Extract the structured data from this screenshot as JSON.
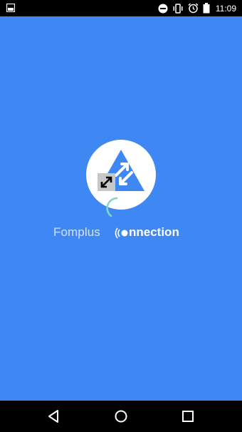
{
  "status_bar": {
    "left_icon": "image-notification-icon",
    "icons": [
      "do-not-disturb-icon",
      "vibrate-icon",
      "alarm-icon",
      "battery-icon"
    ],
    "time": "11:09"
  },
  "splash": {
    "logo_icon": "triangle-arrows-logo",
    "brand_name": "Fomplus",
    "brand_suffix": "nnection",
    "colors": {
      "background": "#3f88f3",
      "logo_triangle": "#3f88f3",
      "spinner": "#7fd6c4"
    }
  },
  "nav_bar": {
    "buttons": [
      "back-icon",
      "home-icon",
      "recent-apps-icon"
    ]
  }
}
